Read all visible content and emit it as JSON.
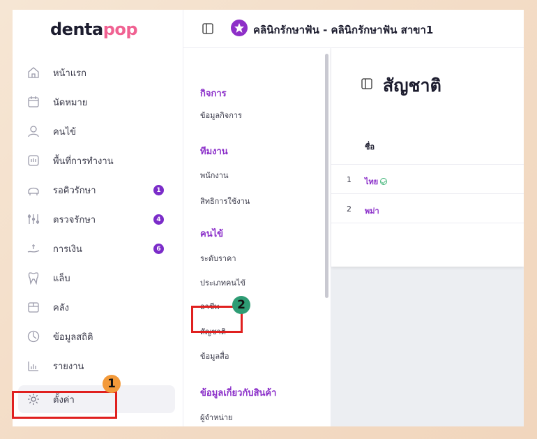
{
  "brand": {
    "logo_main": "denta",
    "logo_accent": "pop"
  },
  "header": {
    "clinic_title": "คลินิกรักษาฟัน - คลินิกรักษาฟัน สาขา1"
  },
  "sidebar": {
    "items": [
      {
        "label": "หน้าแรก",
        "icon": "home-icon"
      },
      {
        "label": "นัดหมาย",
        "icon": "calendar-icon"
      },
      {
        "label": "คนไข้",
        "icon": "user-icon"
      },
      {
        "label": "พื้นที่การทำงาน",
        "icon": "workspace-icon"
      },
      {
        "label": "รอคิวรักษา",
        "icon": "dental-chair-icon",
        "badge": "1"
      },
      {
        "label": "ตรวจรักษา",
        "icon": "treatment-icon",
        "badge": "4"
      },
      {
        "label": "การเงิน",
        "icon": "money-icon",
        "badge": "6"
      },
      {
        "label": "แล็บ",
        "icon": "tooth-icon"
      },
      {
        "label": "คลัง",
        "icon": "box-icon"
      },
      {
        "label": "ข้อมูลสถิติ",
        "icon": "stats-icon"
      },
      {
        "label": "รายงาน",
        "icon": "report-icon"
      },
      {
        "label": "ตั้งค่า",
        "icon": "gear-icon"
      }
    ]
  },
  "settings_menu": {
    "sections": [
      {
        "heading": "กิจการ",
        "items": [
          "ข้อมูลกิจการ"
        ]
      },
      {
        "heading": "ทีมงาน",
        "items": [
          "พนักงาน",
          "สิทธิการใช้งาน"
        ]
      },
      {
        "heading": "คนไข้",
        "items": [
          "ระดับราคา",
          "ประเภทคนไข้",
          "อาชีพ",
          "สัญชาติ",
          "ข้อมูลสื่อ"
        ]
      },
      {
        "heading": "ข้อมูลเกี่ยวกับสินค้า",
        "items": [
          "ผู้จำหน่าย"
        ]
      }
    ]
  },
  "main": {
    "page_title": "สัญชาติ",
    "table": {
      "header": "ชื่อ",
      "rows": [
        {
          "index": "1",
          "name": "ไทย",
          "default": true
        },
        {
          "index": "2",
          "name": "พม่า",
          "default": false
        }
      ]
    }
  },
  "annotations": {
    "marker_1": "1",
    "marker_2": "2"
  },
  "colors": {
    "accent": "#8b2fc9",
    "badge": "#7b2cc9",
    "callout": "#e0201f",
    "marker_1": "#f39a3a",
    "marker_2": "#2e9c74"
  }
}
